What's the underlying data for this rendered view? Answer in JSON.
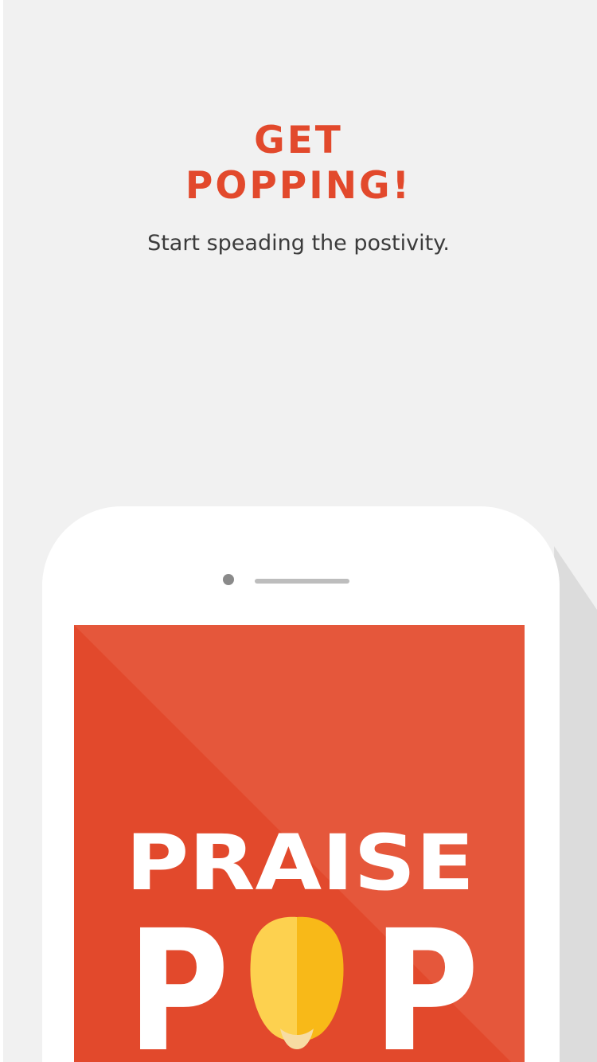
{
  "onboarding": {
    "heading_line1": "GET",
    "heading_line2": "POPPING!",
    "subtitle": "Start speading the postivity."
  },
  "brand": {
    "word1": "PRAISE",
    "word2": "POP"
  },
  "colors": {
    "accent": "#e2492c",
    "screen_bg": "#e2492c",
    "screen_light": "#e5573b",
    "kernel_light": "#fdd14f",
    "kernel_dark": "#f8b918",
    "kernel_tip": "#f7dca3",
    "background": "#f1f1f1",
    "shadow": "#dcdcdc"
  },
  "icons": {
    "kernel": "popcorn-kernel-icon",
    "camera": "camera-icon",
    "speaker": "speaker-icon"
  }
}
